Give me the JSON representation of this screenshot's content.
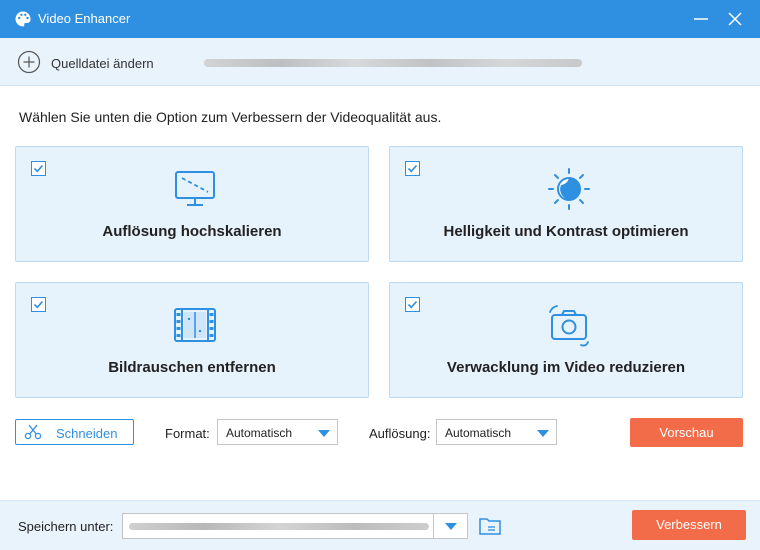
{
  "window": {
    "title": "Video Enhancer"
  },
  "source": {
    "label": "Quelldatei ändern"
  },
  "instruction": "Wählen Sie unten die Option zum Verbessern der Videoqualität aus.",
  "options": [
    {
      "label": "Auflösung hochskalieren",
      "checked": true,
      "icon": "monitor-icon"
    },
    {
      "label": "Helligkeit und Kontrast optimieren",
      "checked": true,
      "icon": "brightness-icon"
    },
    {
      "label": "Bildrauschen entfernen",
      "checked": true,
      "icon": "film-icon"
    },
    {
      "label": "Verwacklung im Video reduzieren",
      "checked": true,
      "icon": "camera-icon"
    }
  ],
  "controls": {
    "cut_label": "Schneiden",
    "format_label": "Format:",
    "format_value": "Automatisch",
    "resolution_label": "Auflösung:",
    "resolution_value": "Automatisch",
    "preview_label": "Vorschau"
  },
  "footer": {
    "save_label": "Speichern unter:",
    "enhance_label": "Verbessern"
  },
  "colors": {
    "accent": "#2f8fe0",
    "button": "#f26c4a",
    "card_bg": "#e7f3fc"
  }
}
